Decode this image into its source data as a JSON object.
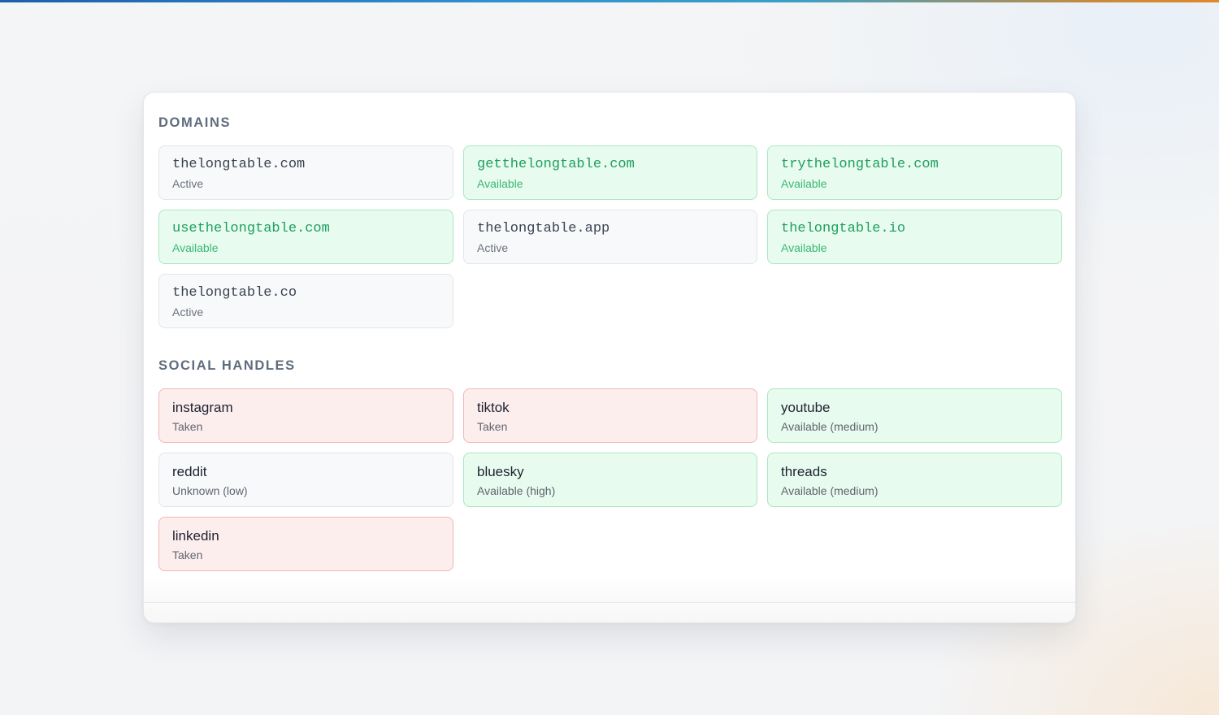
{
  "accent_gradient": [
    "#1d5fa8",
    "#3aa0c8",
    "#e0892a"
  ],
  "colors": {
    "available_bg": "#e8fbef",
    "available_border": "#abe6c4",
    "available_text": "#1f9e60",
    "taken_bg": "#fdeeee",
    "taken_border": "#f0b6b8",
    "neutral_bg": "#f8f9fb",
    "neutral_border": "#e3e5e9"
  },
  "domains": {
    "title": "DOMAINS",
    "items": [
      {
        "name": "thelongtable.com",
        "status": "Active",
        "state": "active"
      },
      {
        "name": "getthelongtable.com",
        "status": "Available",
        "state": "available"
      },
      {
        "name": "trythelongtable.com",
        "status": "Available",
        "state": "available"
      },
      {
        "name": "usethelongtable.com",
        "status": "Available",
        "state": "available"
      },
      {
        "name": "thelongtable.app",
        "status": "Active",
        "state": "active"
      },
      {
        "name": "thelongtable.io",
        "status": "Available",
        "state": "available"
      },
      {
        "name": "thelongtable.co",
        "status": "Active",
        "state": "active"
      }
    ]
  },
  "social": {
    "title": "SOCIAL HANDLES",
    "items": [
      {
        "name": "instagram",
        "status": "Taken",
        "state": "taken"
      },
      {
        "name": "tiktok",
        "status": "Taken",
        "state": "taken"
      },
      {
        "name": "youtube",
        "status": "Available (medium)",
        "state": "available"
      },
      {
        "name": "reddit",
        "status": "Unknown (low)",
        "state": "unknown"
      },
      {
        "name": "bluesky",
        "status": "Available (high)",
        "state": "available"
      },
      {
        "name": "threads",
        "status": "Available (medium)",
        "state": "available"
      },
      {
        "name": "linkedin",
        "status": "Taken",
        "state": "taken"
      }
    ]
  }
}
